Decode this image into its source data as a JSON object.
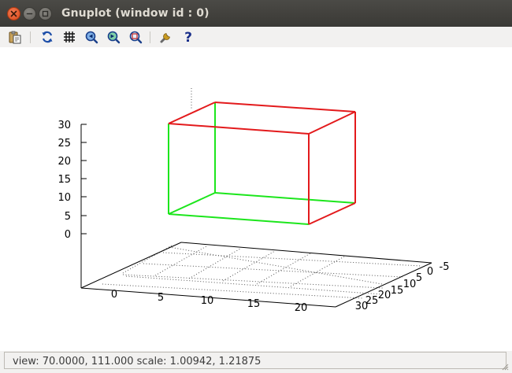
{
  "window": {
    "title": "Gnuplot (window id : 0)"
  },
  "toolbar": {
    "buttons": [
      {
        "name": "copy-to-clipboard",
        "icon": "clipboard-icon"
      },
      {
        "name": "replot",
        "icon": "refresh-icon"
      },
      {
        "name": "toggle-grid",
        "icon": "grid-icon"
      },
      {
        "name": "previous-zoom",
        "icon": "zoom-previous-icon"
      },
      {
        "name": "next-zoom",
        "icon": "zoom-next-icon"
      },
      {
        "name": "autoscale",
        "icon": "zoom-autoscale-icon"
      },
      {
        "name": "settings",
        "icon": "wrench-icon"
      },
      {
        "name": "help",
        "icon": "help-icon"
      }
    ]
  },
  "plot": {
    "z_ticks": [
      "30",
      "25",
      "20",
      "15",
      "10",
      "5",
      "0"
    ],
    "x_ticks": [
      "0",
      "5",
      "10",
      "15",
      "20"
    ],
    "y_ticks": [
      "-5",
      "0",
      "5",
      "10",
      "15",
      "20",
      "25",
      "30"
    ],
    "colors": {
      "box_front": "#e31a1c",
      "box_back": "#1ce61c",
      "axes": "#000000",
      "grid": "#555555"
    }
  },
  "status": {
    "text": "view: 70.0000,  111.000  scale: 1.00942,  1.21875"
  }
}
